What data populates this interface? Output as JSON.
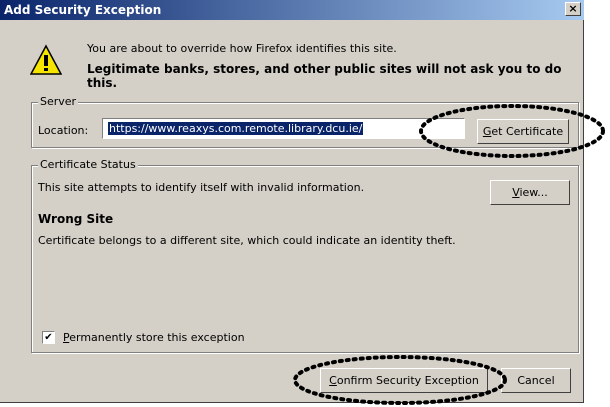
{
  "window": {
    "title": "Add Security Exception",
    "close_label": "×"
  },
  "header": {
    "intro": "You are about to override how Firefox identifies this site.",
    "warning": "Legitimate banks, stores, and other public sites will not ask you to do this."
  },
  "server": {
    "group_label": "Server",
    "location_label": "Location:",
    "location_value": "https://www.reaxys.com.remote.library.dcu.ie/",
    "get_cert_prefix": "G",
    "get_cert_rest": "et Certificate"
  },
  "certificate_status": {
    "group_label": "Certificate Status",
    "status_text": "This site attempts to identify itself with invalid information.",
    "view_prefix": "V",
    "view_rest": "iew...",
    "wrong_site_heading": "Wrong Site",
    "wrong_site_text": "Certificate belongs to a different site, which could indicate an identity theft."
  },
  "options": {
    "permanent_prefix": "P",
    "permanent_rest": "ermanently store this exception",
    "permanent_checked": true,
    "check_mark": "✔"
  },
  "buttons": {
    "confirm_prefix": "C",
    "confirm_rest": "onfirm Security Exception",
    "cancel": "Cancel"
  },
  "colors": {
    "title_bar": "#0a246a",
    "dialog_bg": "#d4d0c8",
    "selection": "#0a246a",
    "warning_yellow": "#f5e400"
  }
}
